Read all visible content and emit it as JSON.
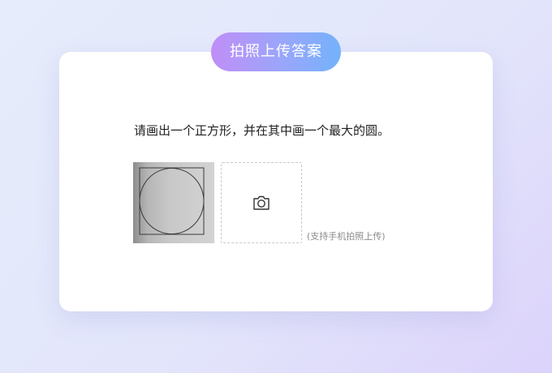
{
  "header": {
    "title": "拍照上传答案"
  },
  "question": {
    "text": "请画出一个正方形，并在其中画一个最大的圆。"
  },
  "answer": {
    "photo_alt": "square-with-inscribed-circle-photo",
    "upload_icon": "camera-icon",
    "hint": "(支持手机拍照上传)"
  }
}
